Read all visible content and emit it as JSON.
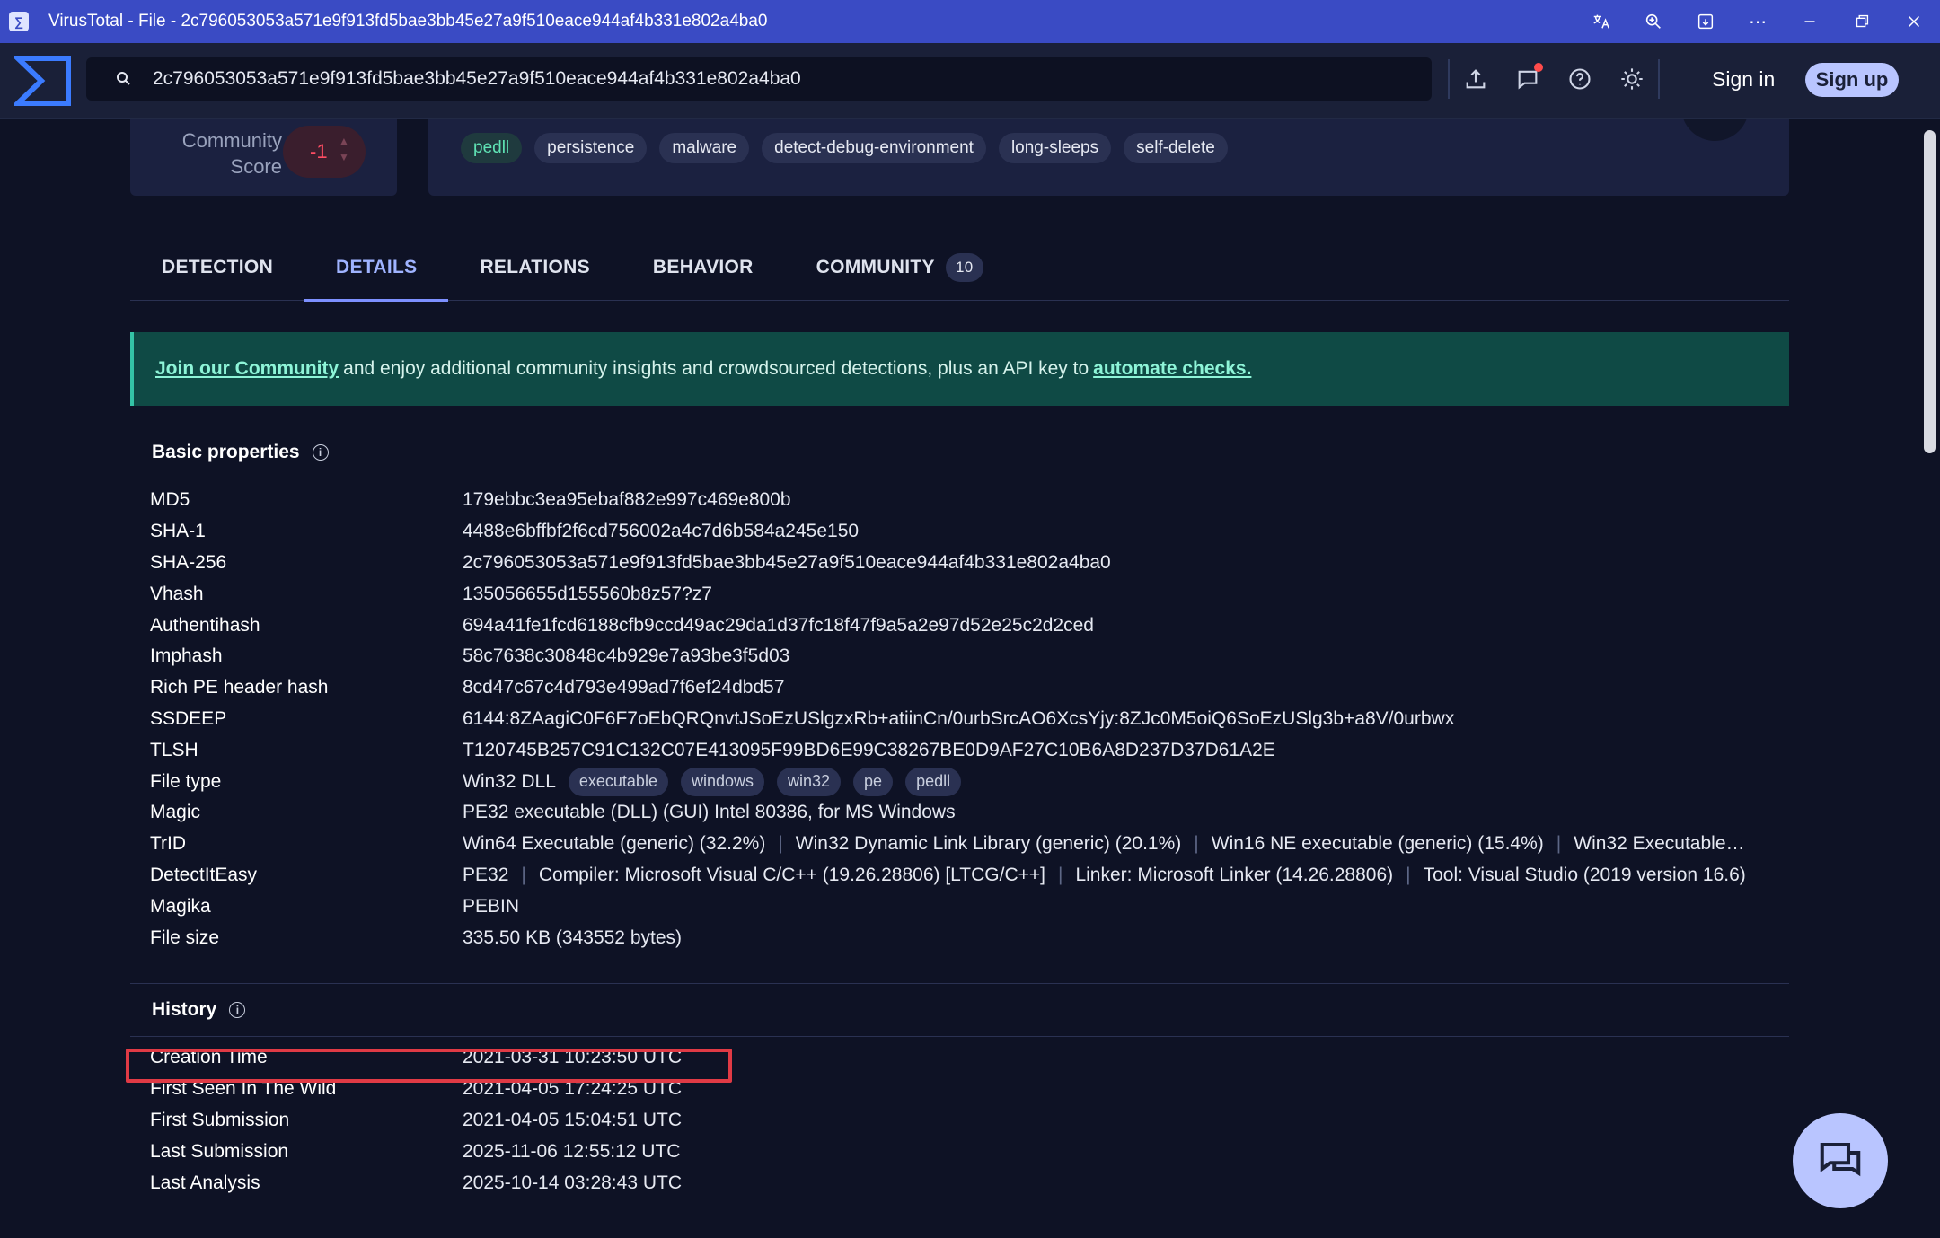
{
  "window": {
    "title": "VirusTotal - File - 2c796053053a571e9f913fd5bae3bb45e27a9f510eace944af4b331e802a4ba0"
  },
  "search": {
    "value": "2c796053053a571e9f913fd5bae3bb45e27a9f510eace944af4b331e802a4ba0"
  },
  "header": {
    "sign_in": "Sign in",
    "sign_up": "Sign up"
  },
  "community_score": {
    "label_line1": "Community",
    "label_line2": "Score",
    "value": "-1"
  },
  "tags": [
    "pedll",
    "persistence",
    "malware",
    "detect-debug-environment",
    "long-sleeps",
    "self-delete"
  ],
  "tabs": [
    {
      "label": "DETECTION"
    },
    {
      "label": "DETAILS"
    },
    {
      "label": "RELATIONS"
    },
    {
      "label": "BEHAVIOR"
    },
    {
      "label": "COMMUNITY",
      "count": "10"
    }
  ],
  "banner": {
    "link1": "Join our Community",
    "middle": "and enjoy additional community insights and crowdsourced detections, plus an API key to",
    "link2": "automate checks."
  },
  "basic_properties": {
    "title": "Basic properties",
    "rows": [
      {
        "k": "MD5",
        "v": "179ebbc3ea95ebaf882e997c469e800b"
      },
      {
        "k": "SHA-1",
        "v": "4488e6bffbf2f6cd756002a4c7d6b584a245e150"
      },
      {
        "k": "SHA-256",
        "v": "2c796053053a571e9f913fd5bae3bb45e27a9f510eace944af4b331e802a4ba0"
      },
      {
        "k": "Vhash",
        "v": "135056655d155560b8z57?z7"
      },
      {
        "k": "Authentihash",
        "v": "694a41fe1fcd6188cfb9ccd49ac29da1d37fc18f47f9a5a2e97d52e25c2d2ced"
      },
      {
        "k": "Imphash",
        "v": "58c7638c30848c4b929e7a93be3f5d03"
      },
      {
        "k": "Rich PE header hash",
        "v": "8cd47c67c4d793e499ad7f6ef24dbd57"
      },
      {
        "k": "SSDEEP",
        "v": "6144:8ZAagiC0F6F7oEbQRQnvtJSoEzUSlgzxRb+atiinCn/0urbSrcAO6XcsYjy:8ZJc0M5oiQ6SoEzUSlg3b+a8V/0urbwx"
      },
      {
        "k": "TLSH",
        "v": "T120745B257C91C132C07E413095F99BD6E99C38267BE0D9AF27C10B6A8D237D37D61A2E"
      }
    ],
    "file_type": {
      "k": "File type",
      "v": "Win32 DLL",
      "pills": [
        "executable",
        "windows",
        "win32",
        "pe",
        "pedll"
      ]
    },
    "magic": {
      "k": "Magic",
      "v": "PE32 executable (DLL) (GUI) Intel 80386, for MS Windows"
    },
    "trid": {
      "k": "TrID",
      "items": [
        "Win64 Executable (generic) (32.2%)",
        "Win32 Dynamic Link Library (generic) (20.1%)",
        "Win16 NE executable (generic) (15.4%)",
        "Win32 Executable…"
      ]
    },
    "die": {
      "k": "DetectItEasy",
      "items": [
        "PE32",
        "Compiler: Microsoft Visual C/C++ (19.26.28806) [LTCG/C++]",
        "Linker: Microsoft Linker (14.26.28806)",
        "Tool: Visual Studio (2019 version 16.6)"
      ]
    },
    "magika": {
      "k": "Magika",
      "v": "PEBIN"
    },
    "size": {
      "k": "File size",
      "v": "335.50 KB (343552 bytes)"
    }
  },
  "history": {
    "title": "History",
    "rows": [
      {
        "k": "Creation Time",
        "v": "2021-03-31 10:23:50 UTC"
      },
      {
        "k": "First Seen In The Wild",
        "v": "2021-04-05 17:24:25 UTC"
      },
      {
        "k": "First Submission",
        "v": "2021-04-05 15:04:51 UTC"
      },
      {
        "k": "Last Submission",
        "v": "2025-11-06 12:55:12 UTC"
      },
      {
        "k": "Last Analysis",
        "v": "2025-10-14 03:28:43 UTC"
      }
    ]
  },
  "colors": {
    "titlebar": "#3a4bc4",
    "accent": "#7d90ff",
    "banner_bg": "#0f4a45",
    "highlight": "#e03a45",
    "score_negative": "#ff4d63"
  }
}
